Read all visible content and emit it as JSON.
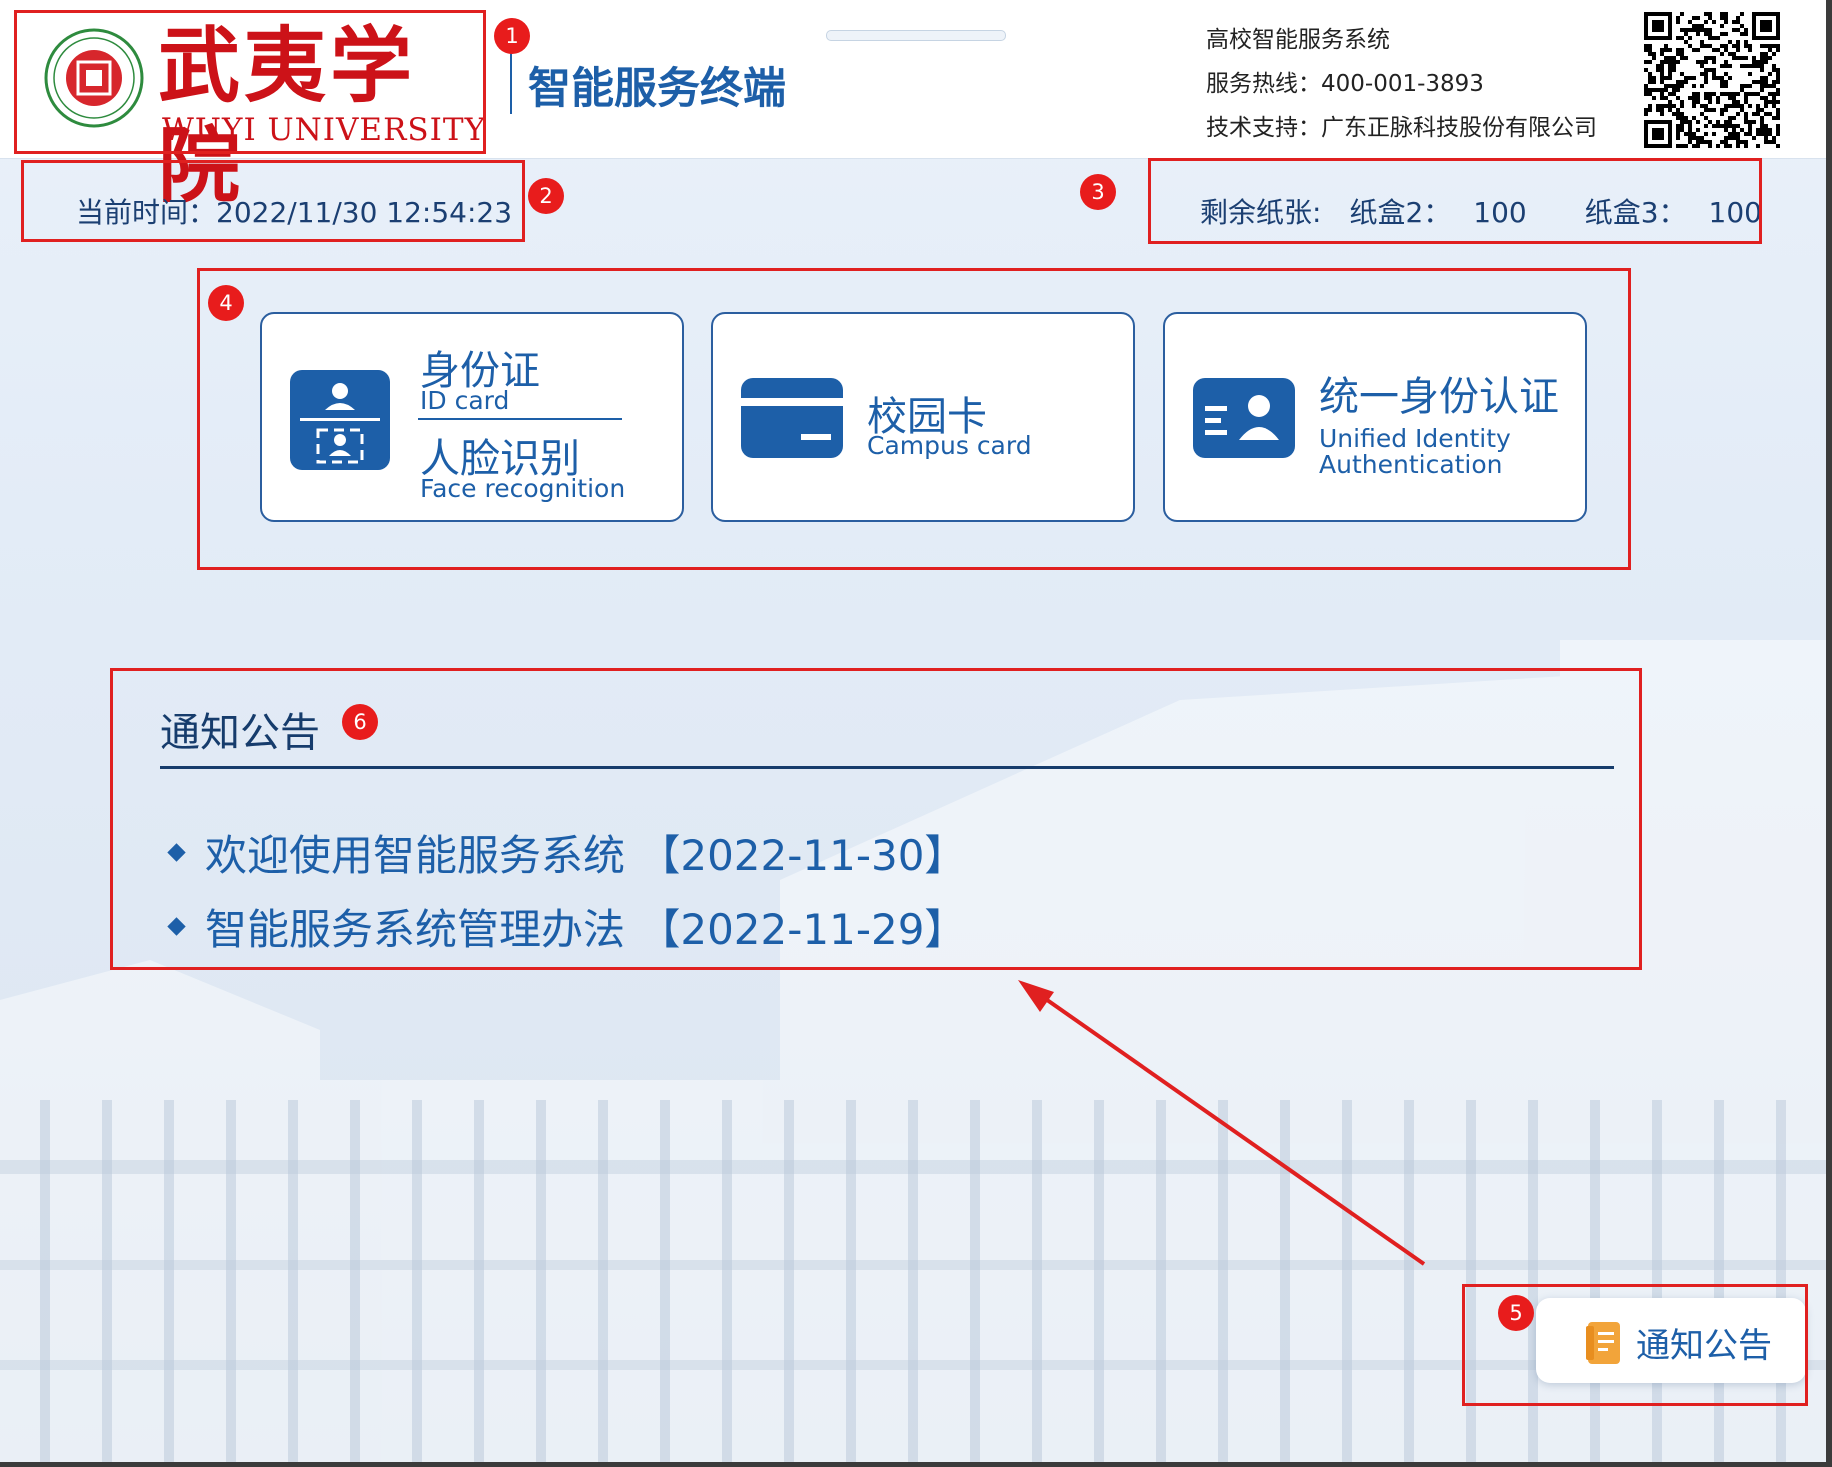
{
  "header": {
    "logo_cn": "武夷学院",
    "logo_en": "WUYI  UNIVERSITY",
    "app_title": "智能服务终端",
    "system_name": "高校智能服务系统",
    "hotline": "服务热线：400-001-3893",
    "support": "技术支持：广东正脉科技股份有限公司"
  },
  "status": {
    "current_time": "当前时间：2022/11/30 12:54:23",
    "paper_label": "剩余纸张:",
    "tray2_label": "纸盒2：",
    "tray2_value": "100",
    "tray3_label": "纸盒3：",
    "tray3_value": "100"
  },
  "login_options": [
    {
      "cn": "身份证",
      "en": "ID card",
      "cn2": "人脸识别",
      "en2": "Face recognition"
    },
    {
      "cn": "校园卡",
      "en": "Campus card"
    },
    {
      "cn": "统一身份认证",
      "en": "Unified Identity",
      "en2": "Authentication"
    }
  ],
  "notice": {
    "title": "通知公告",
    "items": [
      {
        "text": "欢迎使用智能服务系统 【2022-11-30】"
      },
      {
        "text": "智能服务系统管理办法 【2022-11-29】"
      }
    ],
    "button_label": "通知公告"
  },
  "annotations": [
    "1",
    "2",
    "3",
    "4",
    "5",
    "6"
  ],
  "colors": {
    "brand_red": "#cc1218",
    "primary_blue": "#1d5fa8",
    "annotation_red": "#e02020"
  }
}
